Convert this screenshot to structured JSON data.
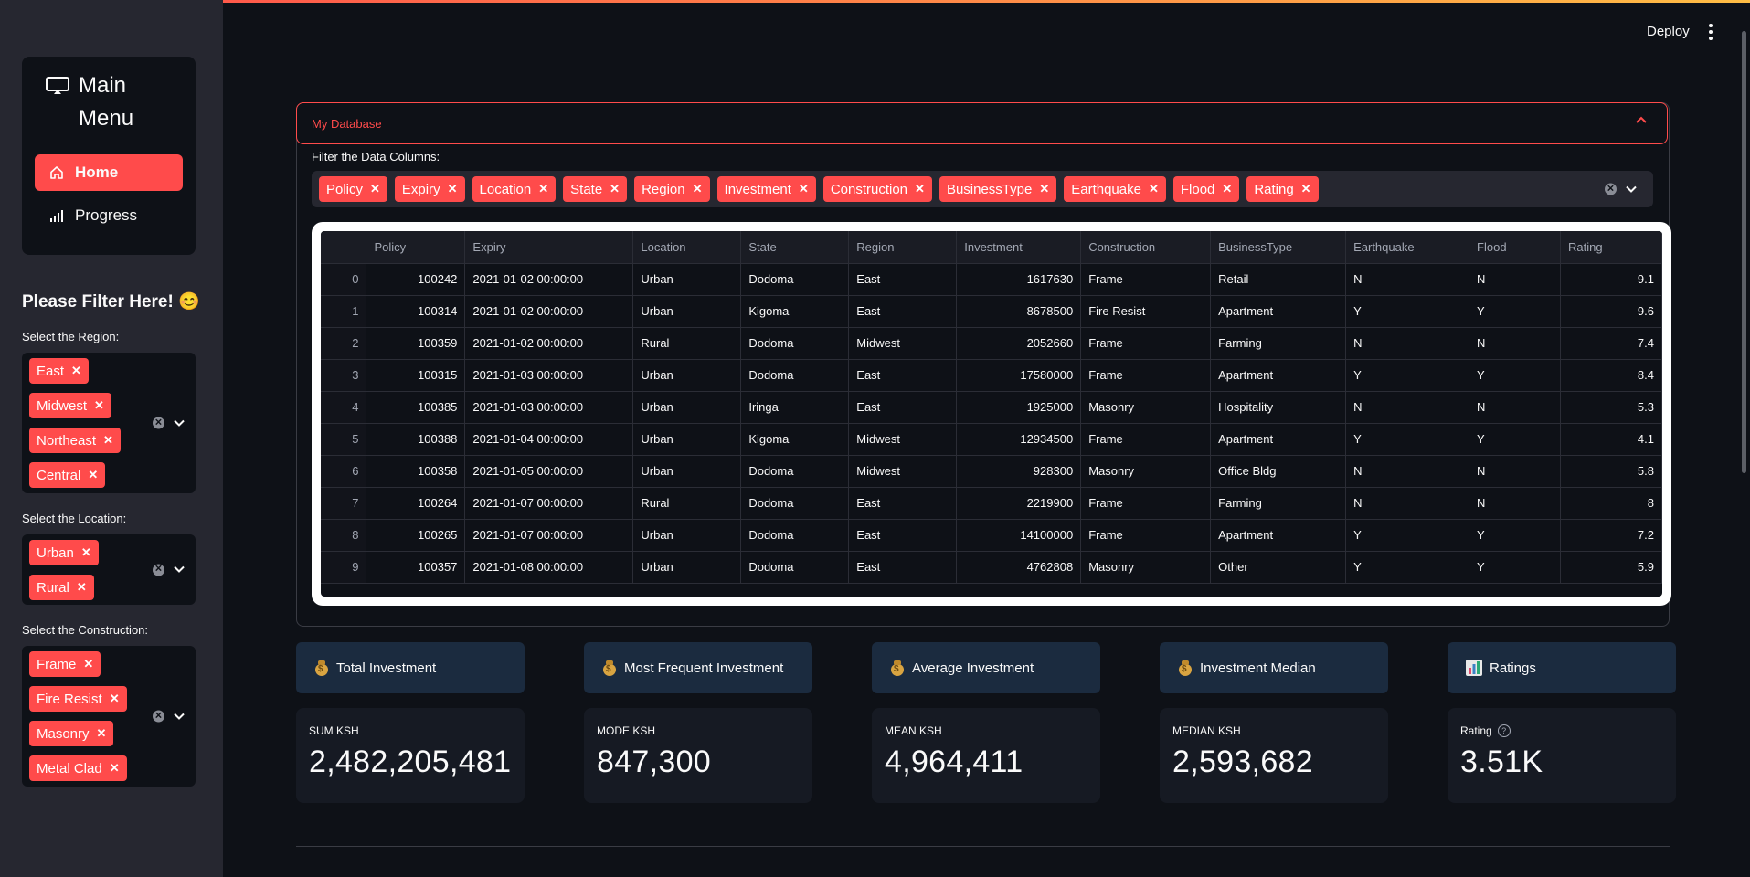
{
  "header": {
    "deploy_label": "Deploy"
  },
  "sidebar": {
    "menu_title": "Main Menu",
    "nav": [
      {
        "label": "Home",
        "icon": "house-icon",
        "active": true
      },
      {
        "label": "Progress",
        "icon": "bar-chart-icon",
        "active": false
      }
    ],
    "filter_heading": "Please Filter Here! 😊",
    "region": {
      "label": "Select the Region:",
      "tags": [
        "East",
        "Midwest",
        "Northeast",
        "Central"
      ]
    },
    "location": {
      "label": "Select the Location:",
      "tags": [
        "Urban",
        "Rural"
      ]
    },
    "construction": {
      "label": "Select the Construction:",
      "tags": [
        "Frame",
        "Fire Resist",
        "Masonry",
        "Metal Clad"
      ]
    }
  },
  "expander": {
    "title": "My Database",
    "columns_label": "Filter the Data Columns:",
    "column_tags": [
      "Policy",
      "Expiry",
      "Location",
      "State",
      "Region",
      "Investment",
      "Construction",
      "BusinessType",
      "Earthquake",
      "Flood",
      "Rating"
    ]
  },
  "table": {
    "headers": [
      "",
      "Policy",
      "Expiry",
      "Location",
      "State",
      "Region",
      "Investment",
      "Construction",
      "BusinessType",
      "Earthquake",
      "Flood",
      "Rating"
    ],
    "rows": [
      [
        "0",
        "100242",
        "2021-01-02 00:00:00",
        "Urban",
        "Dodoma",
        "East",
        "1617630",
        "Frame",
        "Retail",
        "N",
        "N",
        "9.1"
      ],
      [
        "1",
        "100314",
        "2021-01-02 00:00:00",
        "Urban",
        "Kigoma",
        "East",
        "8678500",
        "Fire Resist",
        "Apartment",
        "Y",
        "Y",
        "9.6"
      ],
      [
        "2",
        "100359",
        "2021-01-02 00:00:00",
        "Rural",
        "Dodoma",
        "Midwest",
        "2052660",
        "Frame",
        "Farming",
        "N",
        "N",
        "7.4"
      ],
      [
        "3",
        "100315",
        "2021-01-03 00:00:00",
        "Urban",
        "Dodoma",
        "East",
        "17580000",
        "Frame",
        "Apartment",
        "Y",
        "Y",
        "8.4"
      ],
      [
        "4",
        "100385",
        "2021-01-03 00:00:00",
        "Urban",
        "Iringa",
        "East",
        "1925000",
        "Masonry",
        "Hospitality",
        "N",
        "N",
        "5.3"
      ],
      [
        "5",
        "100388",
        "2021-01-04 00:00:00",
        "Urban",
        "Kigoma",
        "Midwest",
        "12934500",
        "Frame",
        "Apartment",
        "Y",
        "Y",
        "4.1"
      ],
      [
        "6",
        "100358",
        "2021-01-05 00:00:00",
        "Urban",
        "Dodoma",
        "Midwest",
        "928300",
        "Masonry",
        "Office Bldg",
        "N",
        "N",
        "5.8"
      ],
      [
        "7",
        "100264",
        "2021-01-07 00:00:00",
        "Rural",
        "Dodoma",
        "East",
        "2219900",
        "Frame",
        "Farming",
        "N",
        "N",
        "8"
      ],
      [
        "8",
        "100265",
        "2021-01-07 00:00:00",
        "Urban",
        "Dodoma",
        "East",
        "14100000",
        "Frame",
        "Apartment",
        "Y",
        "Y",
        "7.2"
      ],
      [
        "9",
        "100357",
        "2021-01-08 00:00:00",
        "Urban",
        "Dodoma",
        "East",
        "4762808",
        "Masonry",
        "Other",
        "Y",
        "Y",
        "5.9"
      ]
    ]
  },
  "metrics": [
    {
      "head": "Total Investment",
      "head_icon": "money-bag-icon",
      "label": "SUM KSH",
      "value": "2,482,205,481",
      "help": false
    },
    {
      "head": "Most Frequent Investment",
      "head_icon": "money-bag-icon",
      "label": "MODE KSH",
      "value": "847,300",
      "help": false
    },
    {
      "head": "Average Investment",
      "head_icon": "money-bag-icon",
      "label": "MEAN KSH",
      "value": "4,964,411",
      "help": false
    },
    {
      "head": "Investment Median",
      "head_icon": "money-bag-icon",
      "label": "MEDIAN KSH",
      "value": "2,593,682",
      "help": false
    },
    {
      "head": "Ratings",
      "head_icon": "bar-chart-icon",
      "label": "Rating",
      "value": "3.51K",
      "help": true
    }
  ],
  "colors": {
    "accent": "#ff4b4b",
    "background": "#0e1117",
    "sidebar": "#262730",
    "metric_head": "#1b2b3f"
  }
}
